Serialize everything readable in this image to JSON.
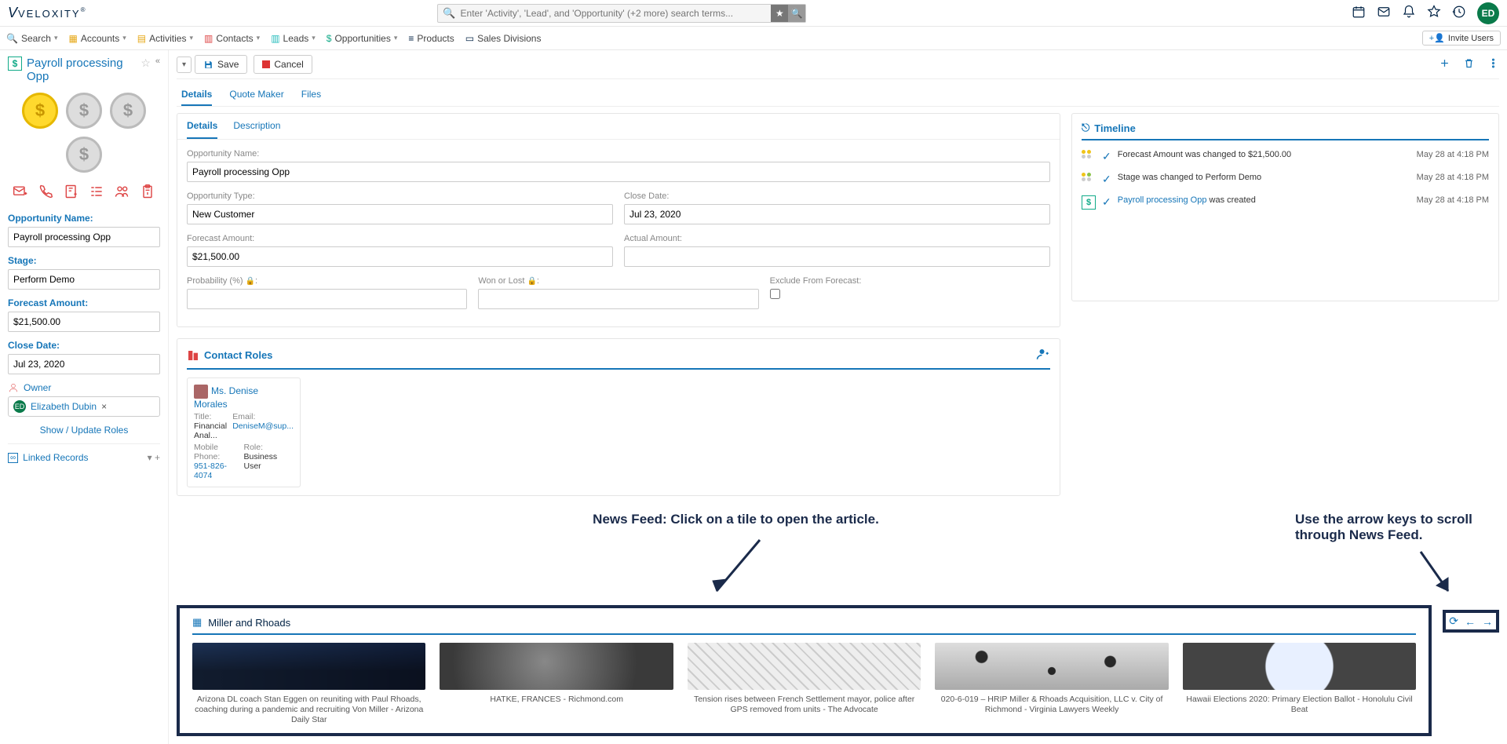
{
  "brand": "VELOXITY",
  "search": {
    "placeholder": "Enter 'Activity', 'Lead', and 'Opportunity' (+2 more) search terms..."
  },
  "avatar": "ED",
  "nav": {
    "search": "Search",
    "accounts": "Accounts",
    "activities": "Activities",
    "contacts": "Contacts",
    "leads": "Leads",
    "opportunities": "Opportunities",
    "products": "Products",
    "salesdiv": "Sales Divisions",
    "invite": "Invite Users"
  },
  "left": {
    "title": "Payroll processing Opp",
    "oppname_label": "Opportunity Name:",
    "oppname": "Payroll processing Opp",
    "stage_label": "Stage:",
    "stage": "Perform Demo",
    "forecast_label": "Forecast Amount:",
    "forecast": "$21,500.00",
    "close_label": "Close Date:",
    "close": "Jul 23, 2020",
    "owner_label": "Owner",
    "owner": "Elizabeth Dubin",
    "roleslink": "Show / Update Roles",
    "linked": "Linked Records"
  },
  "rtop": {
    "save": "Save",
    "cancel": "Cancel"
  },
  "tabs": {
    "details": "Details",
    "quote": "Quote Maker",
    "files": "Files"
  },
  "subtabs": {
    "details": "Details",
    "desc": "Description"
  },
  "form": {
    "oppname_l": "Opportunity Name:",
    "oppname": "Payroll processing Opp",
    "opptype_l": "Opportunity Type:",
    "opptype": "New Customer",
    "close_l": "Close Date:",
    "close": "Jul 23, 2020",
    "forecast_l": "Forecast Amount:",
    "forecast": "$21,500.00",
    "actual_l": "Actual Amount:",
    "prob_l": "Probability (%)",
    "wonlost_l": "Won or Lost",
    "exclude_l": "Exclude From Forecast:"
  },
  "contacts": {
    "header": "Contact Roles",
    "name": "Ms. Denise Morales",
    "title_l": "Title:",
    "title": "Financial Anal...",
    "email_l": "Email:",
    "email": "DeniseM@sup...",
    "phone_l": "Mobile Phone:",
    "phone": "951-826-4074",
    "role_l": "Role:",
    "role": "Business User"
  },
  "timeline": {
    "header": "Timeline",
    "items": [
      {
        "text": "Forecast Amount was changed to $21,500.00",
        "date": "May 28 at 4:18 PM",
        "type": "dots1"
      },
      {
        "text": "Stage was changed to Perform Demo",
        "date": "May 28 at 4:18 PM",
        "type": "dots2"
      },
      {
        "link": "Payroll processing Opp",
        "text": " was created",
        "date": "May 28 at 4:18 PM",
        "type": "icon"
      }
    ]
  },
  "annot": {
    "main": "News Feed: Click on a tile to open the article.",
    "side": "Use the arrow keys to scroll through News Feed."
  },
  "news": {
    "header": "Miller and Rhoads",
    "tiles": [
      "Arizona DL coach Stan Eggen on reuniting with Paul Rhoads, coaching during a pandemic and recruiting Von Miller - Arizona Daily Star",
      "HATKE, FRANCES - Richmond.com",
      "Tension rises between French Settlement mayor, police after GPS removed from units - The Advocate",
      "020-6-019 – HRIP Miller & Rhoads Acquisition, LLC v. City of Richmond - Virginia Lawyers Weekly",
      "Hawaii Elections 2020: Primary Election Ballot - Honolulu Civil Beat"
    ]
  }
}
